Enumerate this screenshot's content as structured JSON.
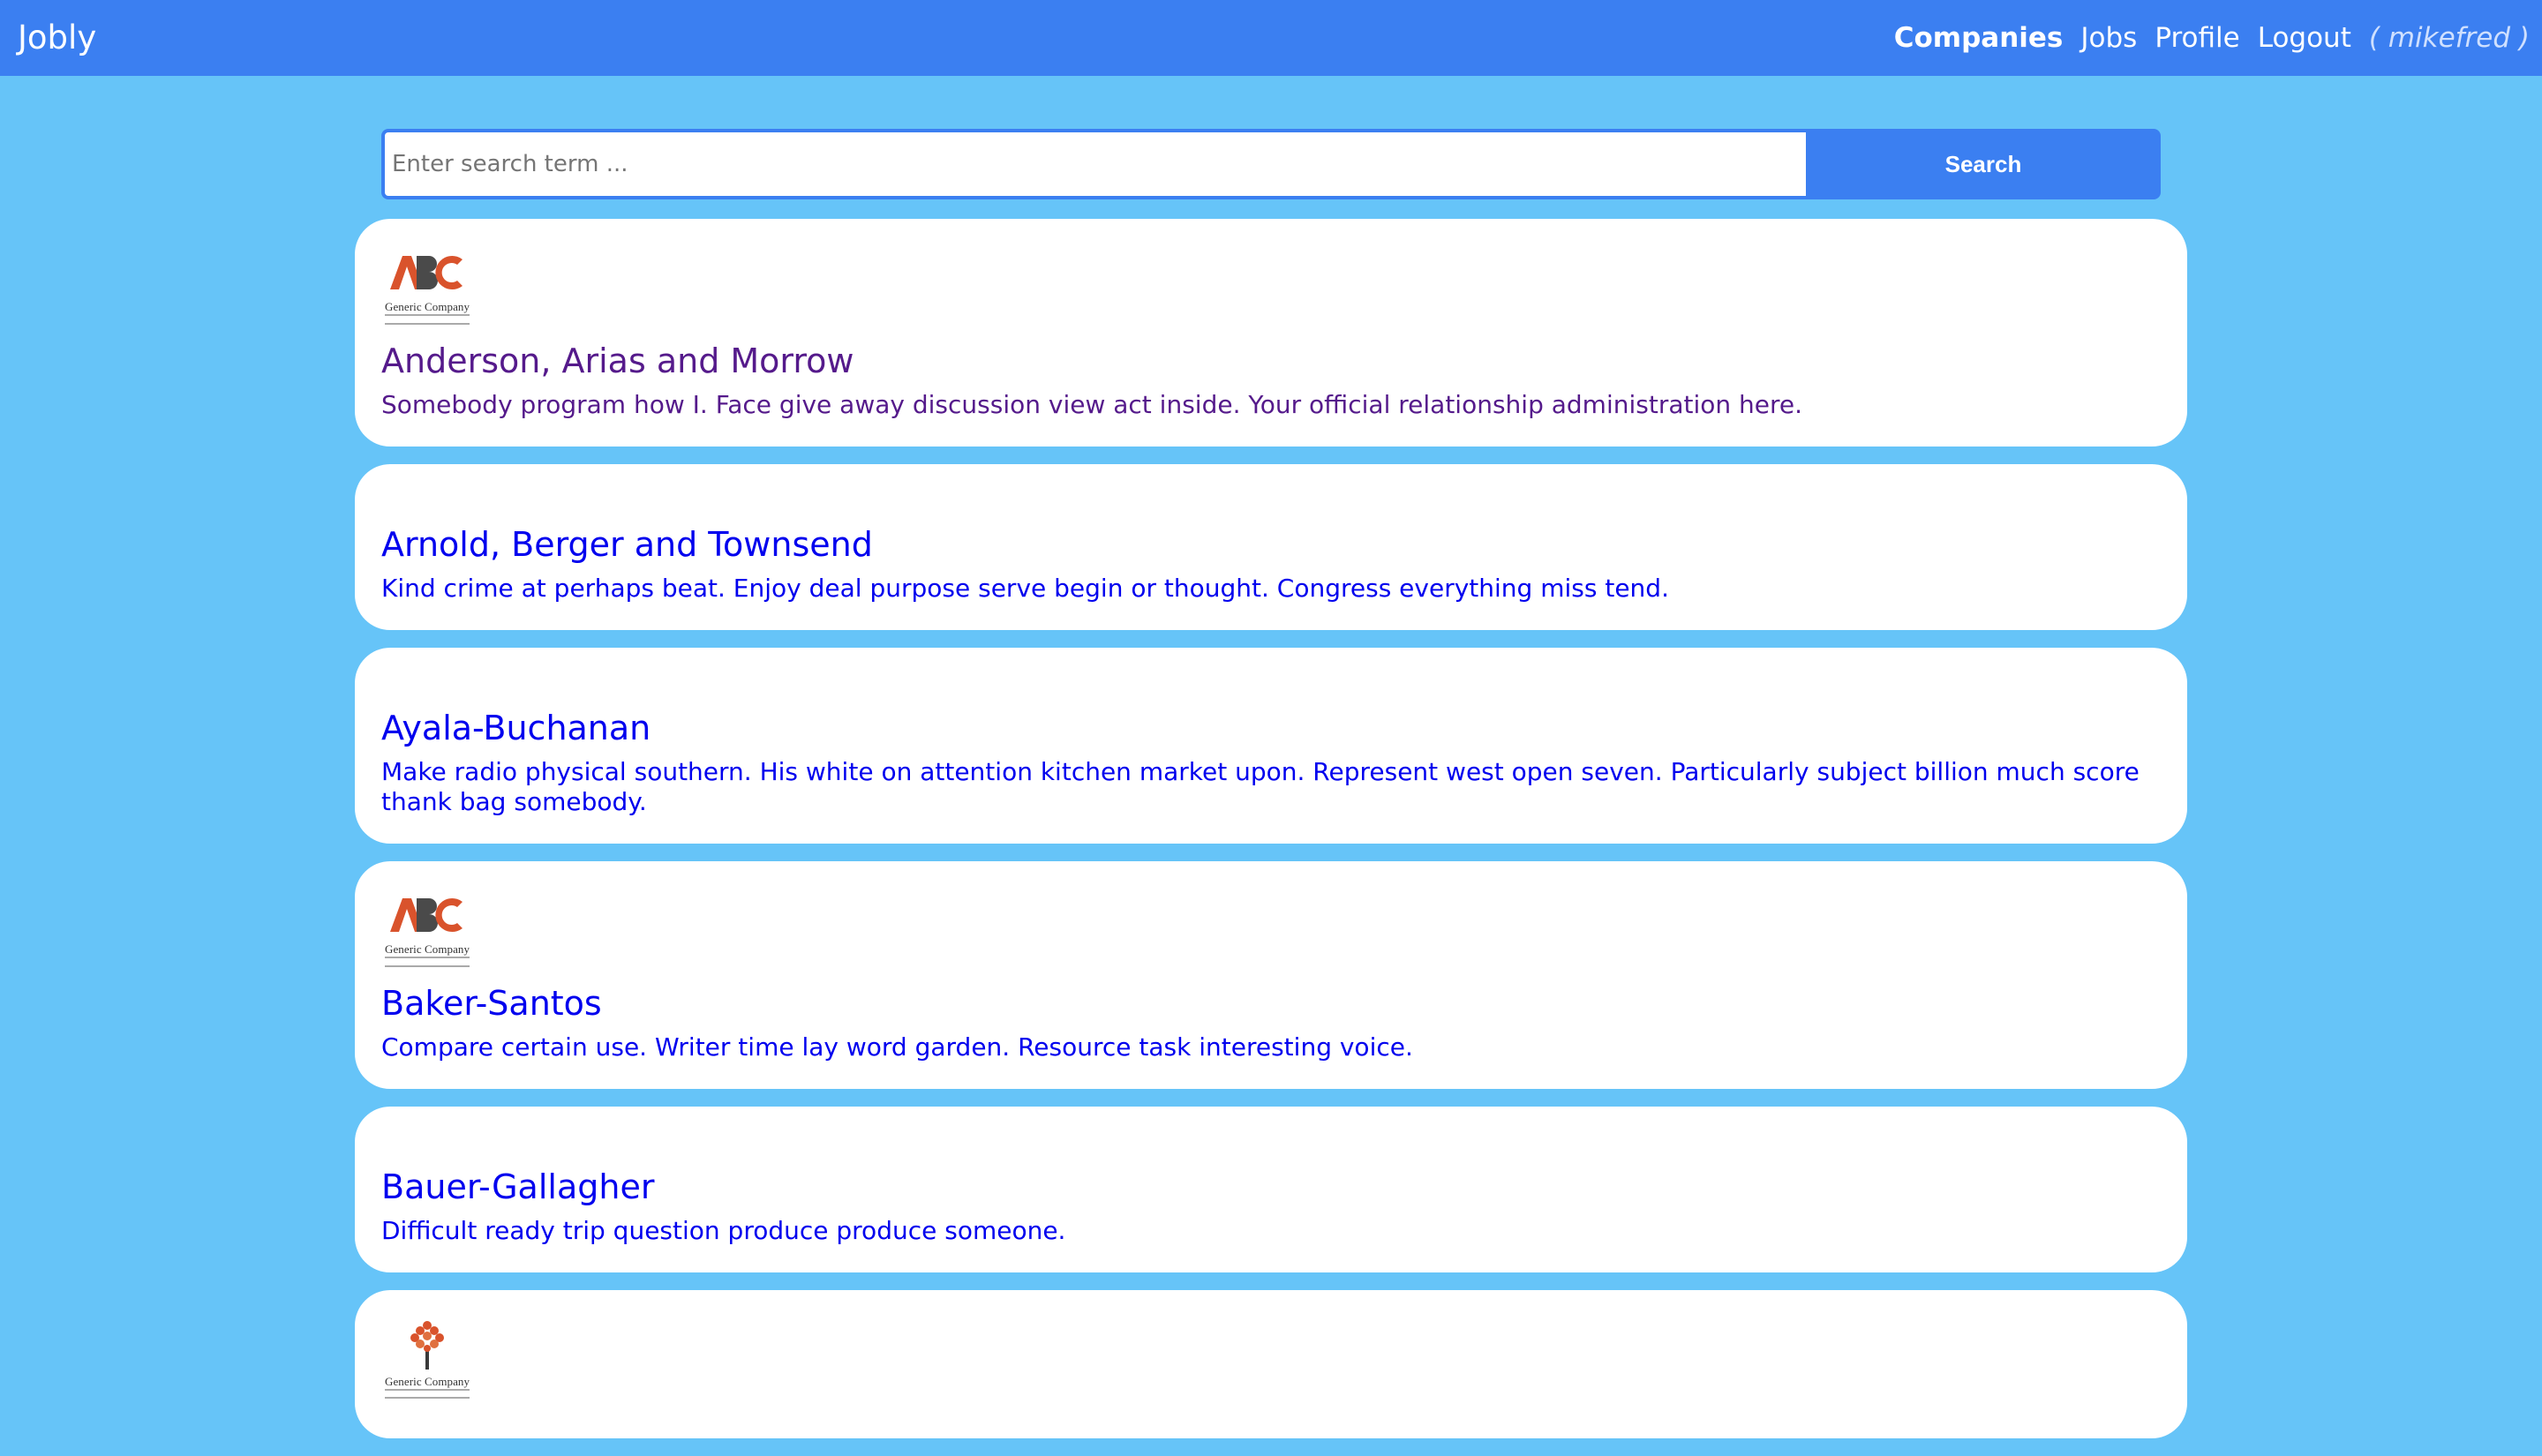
{
  "navbar": {
    "brand": "Jobly",
    "links": [
      {
        "label": "Companies"
      },
      {
        "label": "Jobs"
      },
      {
        "label": "Profile"
      },
      {
        "label": "Logout"
      }
    ],
    "user": "( mikefred )"
  },
  "search": {
    "placeholder": "Enter search term ...",
    "value": "",
    "button_label": "Search"
  },
  "companies": [
    {
      "name": "Anderson, Arias and Morrow",
      "description": "Somebody program how I. Face give away discussion view act inside. Your official relationship administration here.",
      "logo": "abc-generic-company-logo",
      "logo_text": "Generic Company"
    },
    {
      "name": "Arnold, Berger and Townsend",
      "description": "Kind crime at perhaps beat. Enjoy deal purpose serve begin or thought. Congress everything miss tend."
    },
    {
      "name": "Ayala-Buchanan",
      "description": "Make radio physical southern. His white on attention kitchen market upon. Represent west open seven. Particularly subject billion much score thank bag somebody."
    },
    {
      "name": "Baker-Santos",
      "description": "Compare certain use. Writer time lay word garden. Resource task interesting voice.",
      "logo": "abc-generic-company-logo",
      "logo_text": "Generic Company"
    },
    {
      "name": "Bauer-Gallagher",
      "description": "Difficult ready trip question produce produce someone."
    },
    {
      "logo": "tree-generic-company-logo",
      "logo_text": "Generic Company"
    }
  ]
}
